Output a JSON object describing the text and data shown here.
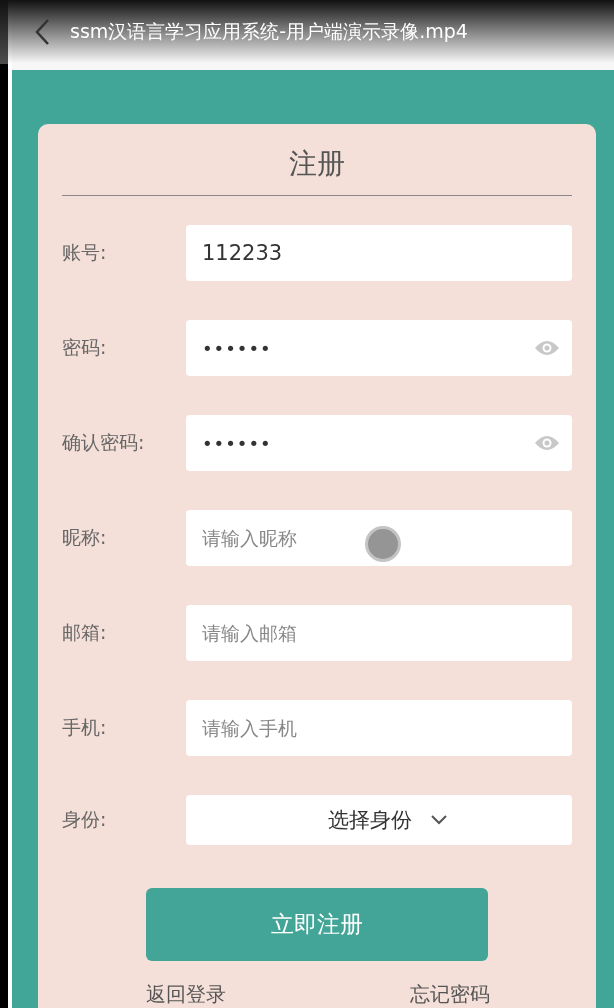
{
  "video_bar": {
    "title": "ssm汉语言学习应用系统-用户端演示录像.mp4"
  },
  "form": {
    "title": "注册",
    "fields": [
      {
        "kind": "text",
        "label": "账号:",
        "value": "112233"
      },
      {
        "kind": "password",
        "label": "密码:",
        "value": "••••••"
      },
      {
        "kind": "password",
        "label": "确认密码:",
        "value": "••••••"
      },
      {
        "kind": "text",
        "label": "昵称:",
        "placeholder": "请输入昵称"
      },
      {
        "kind": "text",
        "label": "邮箱:",
        "placeholder": "请输入邮箱"
      },
      {
        "kind": "text",
        "label": "手机:",
        "placeholder": "请输入手机"
      },
      {
        "kind": "select",
        "label": "身份:",
        "value": "选择身份"
      }
    ],
    "submit": "立即注册",
    "links": [
      "返回登录",
      "忘记密码"
    ]
  }
}
